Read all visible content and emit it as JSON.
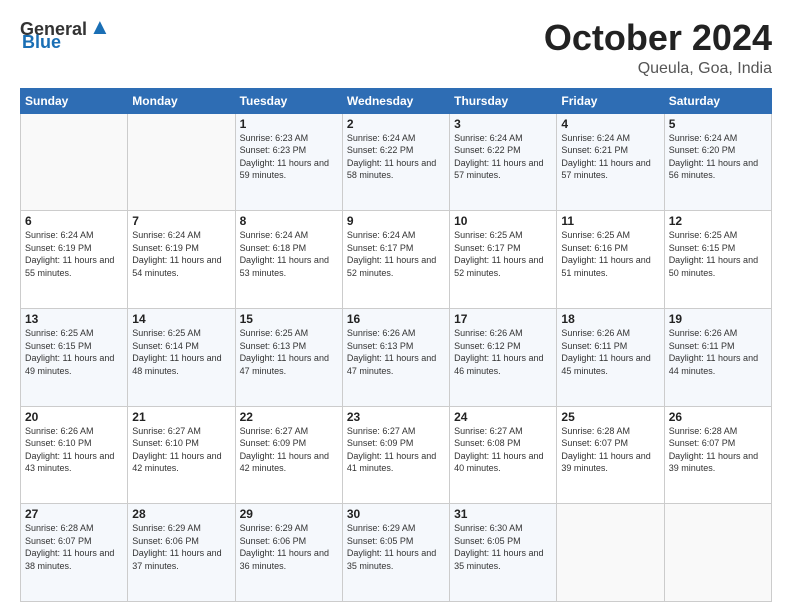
{
  "header": {
    "logo": {
      "general": "General",
      "blue": "Blue",
      "tagline": ""
    },
    "title": "October 2024",
    "location": "Queula, Goa, India"
  },
  "days_of_week": [
    "Sunday",
    "Monday",
    "Tuesday",
    "Wednesday",
    "Thursday",
    "Friday",
    "Saturday"
  ],
  "weeks": [
    [
      {
        "day": "",
        "info": ""
      },
      {
        "day": "",
        "info": ""
      },
      {
        "day": "1",
        "info": "Sunrise: 6:23 AM\nSunset: 6:23 PM\nDaylight: 11 hours and 59 minutes."
      },
      {
        "day": "2",
        "info": "Sunrise: 6:24 AM\nSunset: 6:22 PM\nDaylight: 11 hours and 58 minutes."
      },
      {
        "day": "3",
        "info": "Sunrise: 6:24 AM\nSunset: 6:22 PM\nDaylight: 11 hours and 57 minutes."
      },
      {
        "day": "4",
        "info": "Sunrise: 6:24 AM\nSunset: 6:21 PM\nDaylight: 11 hours and 57 minutes."
      },
      {
        "day": "5",
        "info": "Sunrise: 6:24 AM\nSunset: 6:20 PM\nDaylight: 11 hours and 56 minutes."
      }
    ],
    [
      {
        "day": "6",
        "info": "Sunrise: 6:24 AM\nSunset: 6:19 PM\nDaylight: 11 hours and 55 minutes."
      },
      {
        "day": "7",
        "info": "Sunrise: 6:24 AM\nSunset: 6:19 PM\nDaylight: 11 hours and 54 minutes."
      },
      {
        "day": "8",
        "info": "Sunrise: 6:24 AM\nSunset: 6:18 PM\nDaylight: 11 hours and 53 minutes."
      },
      {
        "day": "9",
        "info": "Sunrise: 6:24 AM\nSunset: 6:17 PM\nDaylight: 11 hours and 52 minutes."
      },
      {
        "day": "10",
        "info": "Sunrise: 6:25 AM\nSunset: 6:17 PM\nDaylight: 11 hours and 52 minutes."
      },
      {
        "day": "11",
        "info": "Sunrise: 6:25 AM\nSunset: 6:16 PM\nDaylight: 11 hours and 51 minutes."
      },
      {
        "day": "12",
        "info": "Sunrise: 6:25 AM\nSunset: 6:15 PM\nDaylight: 11 hours and 50 minutes."
      }
    ],
    [
      {
        "day": "13",
        "info": "Sunrise: 6:25 AM\nSunset: 6:15 PM\nDaylight: 11 hours and 49 minutes."
      },
      {
        "day": "14",
        "info": "Sunrise: 6:25 AM\nSunset: 6:14 PM\nDaylight: 11 hours and 48 minutes."
      },
      {
        "day": "15",
        "info": "Sunrise: 6:25 AM\nSunset: 6:13 PM\nDaylight: 11 hours and 47 minutes."
      },
      {
        "day": "16",
        "info": "Sunrise: 6:26 AM\nSunset: 6:13 PM\nDaylight: 11 hours and 47 minutes."
      },
      {
        "day": "17",
        "info": "Sunrise: 6:26 AM\nSunset: 6:12 PM\nDaylight: 11 hours and 46 minutes."
      },
      {
        "day": "18",
        "info": "Sunrise: 6:26 AM\nSunset: 6:11 PM\nDaylight: 11 hours and 45 minutes."
      },
      {
        "day": "19",
        "info": "Sunrise: 6:26 AM\nSunset: 6:11 PM\nDaylight: 11 hours and 44 minutes."
      }
    ],
    [
      {
        "day": "20",
        "info": "Sunrise: 6:26 AM\nSunset: 6:10 PM\nDaylight: 11 hours and 43 minutes."
      },
      {
        "day": "21",
        "info": "Sunrise: 6:27 AM\nSunset: 6:10 PM\nDaylight: 11 hours and 42 minutes."
      },
      {
        "day": "22",
        "info": "Sunrise: 6:27 AM\nSunset: 6:09 PM\nDaylight: 11 hours and 42 minutes."
      },
      {
        "day": "23",
        "info": "Sunrise: 6:27 AM\nSunset: 6:09 PM\nDaylight: 11 hours and 41 minutes."
      },
      {
        "day": "24",
        "info": "Sunrise: 6:27 AM\nSunset: 6:08 PM\nDaylight: 11 hours and 40 minutes."
      },
      {
        "day": "25",
        "info": "Sunrise: 6:28 AM\nSunset: 6:07 PM\nDaylight: 11 hours and 39 minutes."
      },
      {
        "day": "26",
        "info": "Sunrise: 6:28 AM\nSunset: 6:07 PM\nDaylight: 11 hours and 39 minutes."
      }
    ],
    [
      {
        "day": "27",
        "info": "Sunrise: 6:28 AM\nSunset: 6:07 PM\nDaylight: 11 hours and 38 minutes."
      },
      {
        "day": "28",
        "info": "Sunrise: 6:29 AM\nSunset: 6:06 PM\nDaylight: 11 hours and 37 minutes."
      },
      {
        "day": "29",
        "info": "Sunrise: 6:29 AM\nSunset: 6:06 PM\nDaylight: 11 hours and 36 minutes."
      },
      {
        "day": "30",
        "info": "Sunrise: 6:29 AM\nSunset: 6:05 PM\nDaylight: 11 hours and 35 minutes."
      },
      {
        "day": "31",
        "info": "Sunrise: 6:30 AM\nSunset: 6:05 PM\nDaylight: 11 hours and 35 minutes."
      },
      {
        "day": "",
        "info": ""
      },
      {
        "day": "",
        "info": ""
      }
    ]
  ]
}
